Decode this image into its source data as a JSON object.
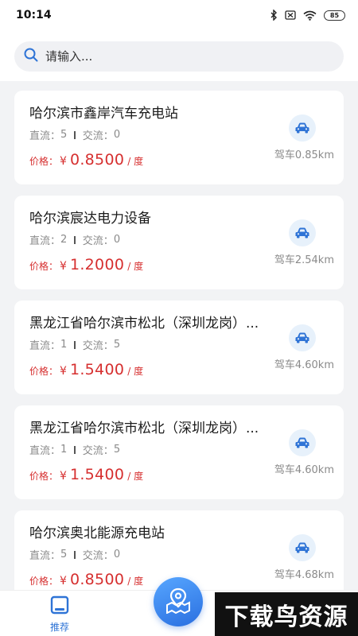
{
  "status_bar": {
    "time": "10:14",
    "battery": "85",
    "icons": [
      "bluetooth-icon",
      "sim-off-icon",
      "wifi-icon",
      "battery-icon"
    ]
  },
  "search": {
    "placeholder": "请输入..."
  },
  "stations": [
    {
      "name": "哈尔滨市鑫岸汽车充电站",
      "dc_label": "直流：",
      "dc": "5",
      "ac_label": "交流：",
      "ac": "0",
      "price_label": "价格：",
      "currency": "¥",
      "price": "0.8500",
      "unit": "/ 度",
      "distance": "驾车0.85km"
    },
    {
      "name": "哈尔滨宸达电力设备",
      "dc_label": "直流：",
      "dc": "2",
      "ac_label": "交流：",
      "ac": "0",
      "price_label": "价格：",
      "currency": "¥",
      "price": "1.2000",
      "unit": "/ 度",
      "distance": "驾车2.54km"
    },
    {
      "name": "黑龙江省哈尔滨市松北（深圳龙岗）...",
      "dc_label": "直流：",
      "dc": "1",
      "ac_label": "交流：",
      "ac": "5",
      "price_label": "价格：",
      "currency": "¥",
      "price": "1.5400",
      "unit": "/ 度",
      "distance": "驾车4.60km"
    },
    {
      "name": "黑龙江省哈尔滨市松北（深圳龙岗）...",
      "dc_label": "直流：",
      "dc": "1",
      "ac_label": "交流：",
      "ac": "5",
      "price_label": "价格：",
      "currency": "¥",
      "price": "1.5400",
      "unit": "/ 度",
      "distance": "驾车4.60km"
    },
    {
      "name": "哈尔滨奥北能源充电站",
      "dc_label": "直流：",
      "dc": "5",
      "ac_label": "交流：",
      "ac": "0",
      "price_label": "价格：",
      "currency": "¥",
      "price": "0.8500",
      "unit": "/ 度",
      "distance": "驾车4.68km"
    }
  ],
  "tabbar": {
    "home_label": "推荐",
    "center_icon": "map-location-icon"
  },
  "watermark": "下载鸟资源",
  "colors": {
    "price": "#d62f2f",
    "accent": "#2f74d6",
    "background": "#f2f3f5"
  }
}
